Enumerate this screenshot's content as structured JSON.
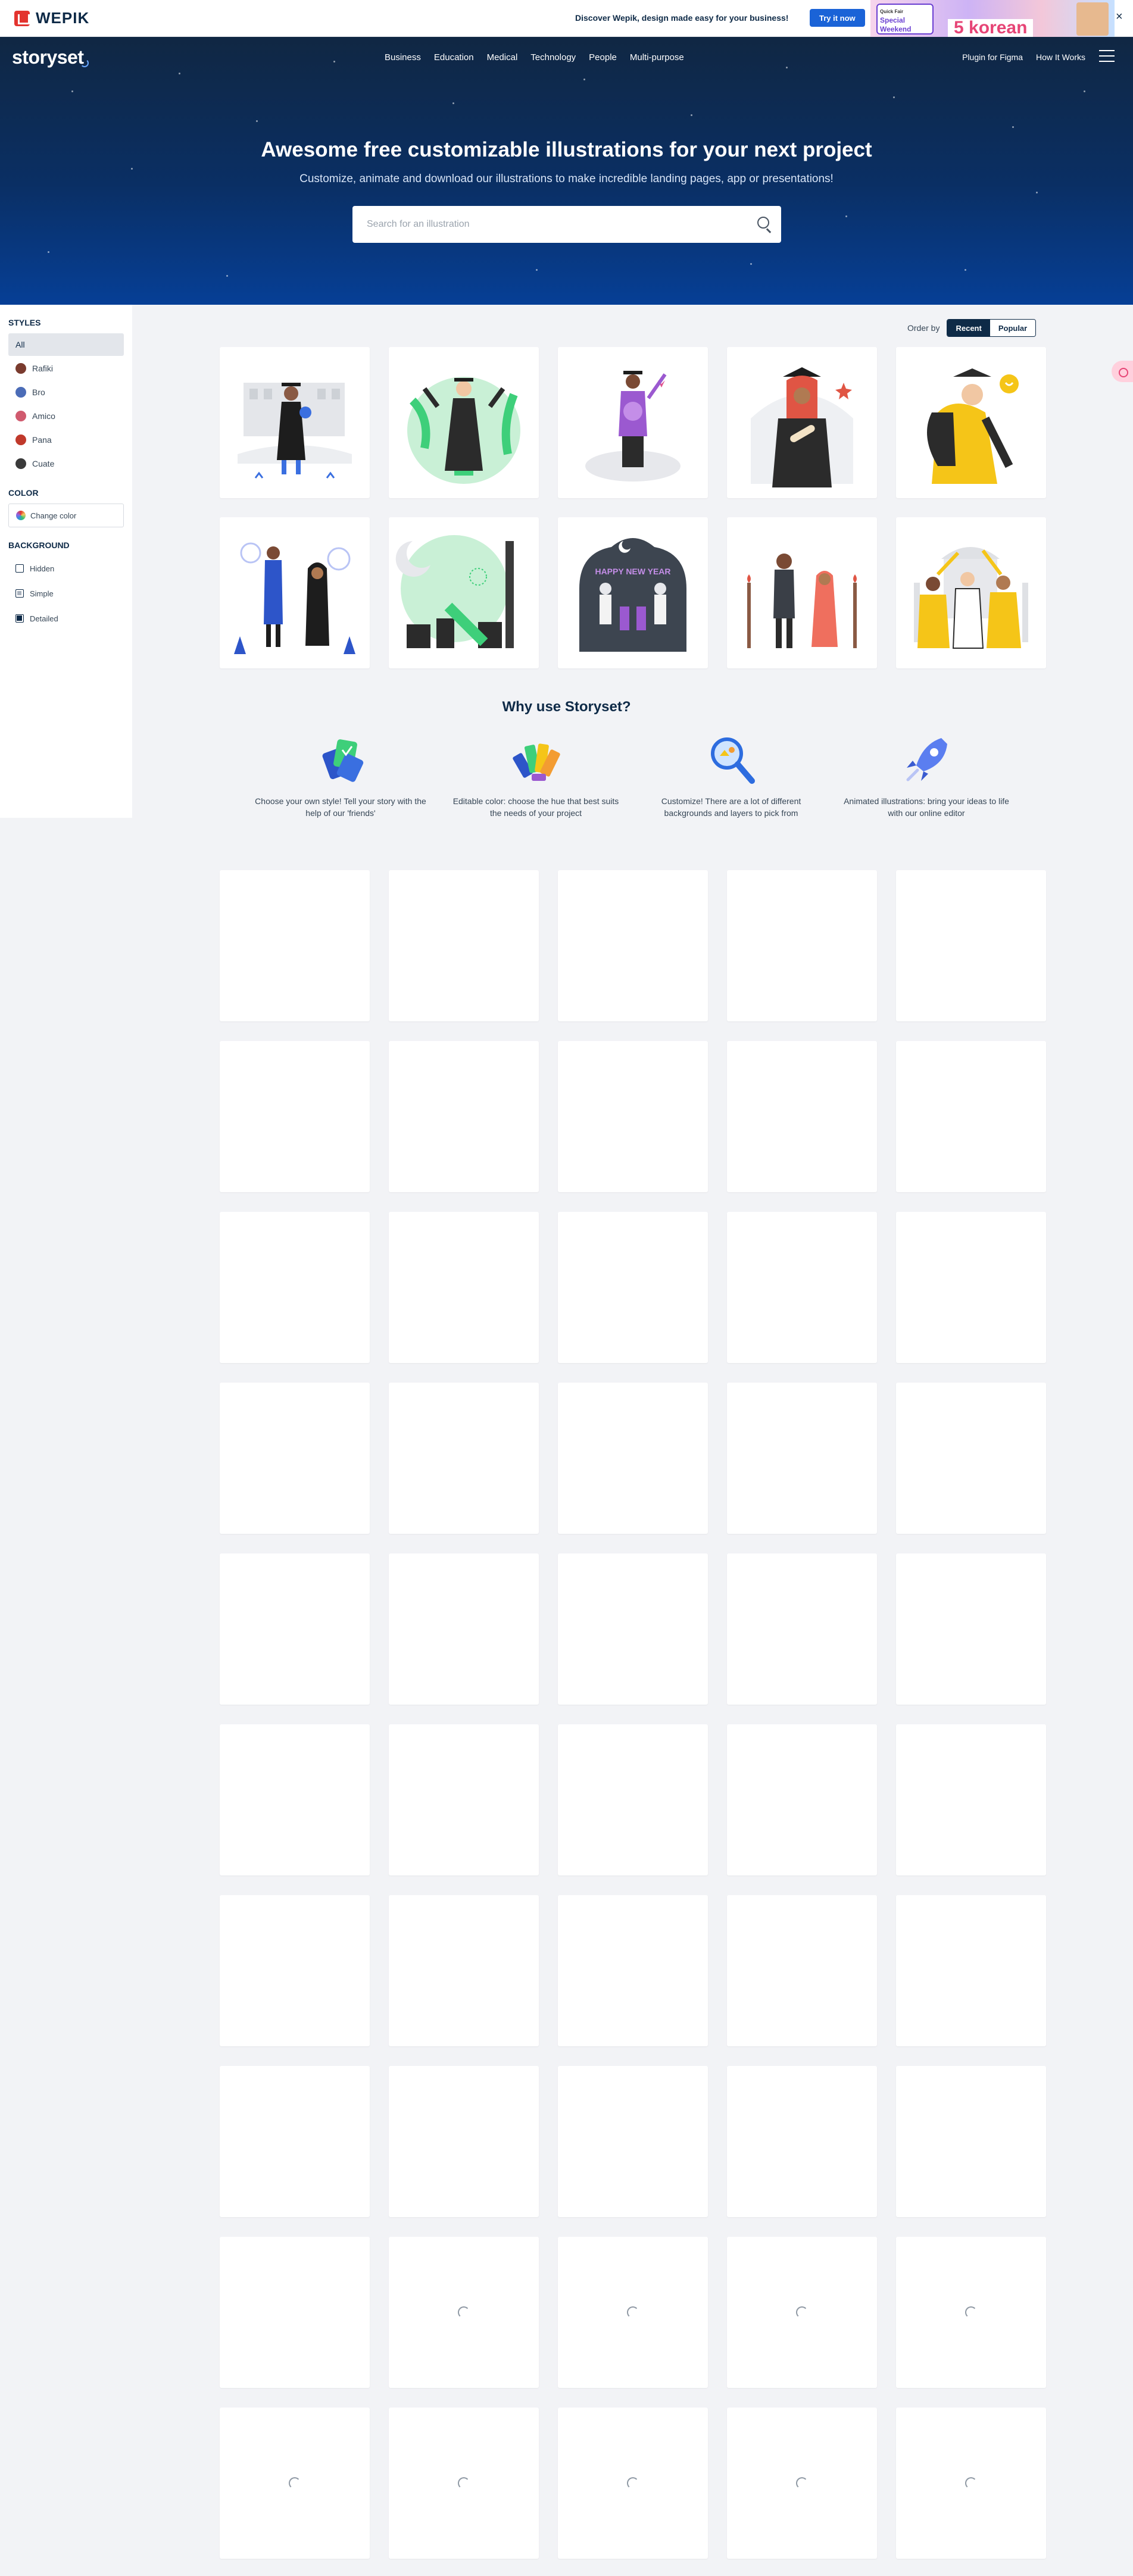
{
  "promo": {
    "brand": "WEPIK",
    "message": "Discover Wepik, design made easy for your business!",
    "cta": "Try it now",
    "banner_tag_small": "Quick Fair",
    "banner_tag_line1": "Special",
    "banner_tag_line2": "Weekend",
    "banner_headline": "5 korean",
    "close": "×"
  },
  "nav": {
    "brand": "storyset",
    "links": [
      "Business",
      "Education",
      "Medical",
      "Technology",
      "People",
      "Multi-purpose"
    ],
    "right": [
      "Plugin for Figma",
      "How It Works"
    ]
  },
  "hero": {
    "title": "Awesome free customizable illustrations for your next project",
    "subtitle": "Customize, animate and download our illustrations to make incredible landing pages, app or presentations!",
    "search_placeholder": "Search for an illustration"
  },
  "sidebar": {
    "styles_heading": "STYLES",
    "styles": [
      {
        "label": "All",
        "active": true,
        "color": ""
      },
      {
        "label": "Rafiki",
        "active": false,
        "color": "#7a3b2e"
      },
      {
        "label": "Bro",
        "active": false,
        "color": "#4b6cb7"
      },
      {
        "label": "Amico",
        "active": false,
        "color": "#d05a6e"
      },
      {
        "label": "Pana",
        "active": false,
        "color": "#c0392b"
      },
      {
        "label": "Cuate",
        "active": false,
        "color": "#3a3a3a"
      }
    ],
    "color_heading": "COLOR",
    "change_color": "Change color",
    "background_heading": "BACKGROUND",
    "backgrounds": [
      "Hidden",
      "Simple",
      "Detailed"
    ]
  },
  "order": {
    "label": "Order by",
    "options": [
      "Recent",
      "Popular"
    ],
    "selected": "Recent"
  },
  "why": {
    "title": "Why use Storyset?",
    "features": [
      {
        "icon": "style-cards-icon",
        "text": "Choose your own style! Tell your story with the help of our 'friends'"
      },
      {
        "icon": "color-palette-icon",
        "text": "Editable color: choose the hue that best suits the needs of your project"
      },
      {
        "icon": "magnifier-icon",
        "text": "Customize! There are a lot of different backgrounds and layers to pick from"
      },
      {
        "icon": "rocket-icon",
        "text": "Animated illustrations: bring your ideas to life with our online editor"
      }
    ]
  },
  "colors": {
    "hero_top": "#102743",
    "hero_bottom": "#063f96",
    "accent_blue": "#1a63d7",
    "navy": "#0e2a47",
    "graduation_green": "#3ecf7a",
    "graduation_purple": "#9b59d0",
    "graduation_red": "#e05544",
    "graduation_yellow": "#f5c518"
  }
}
